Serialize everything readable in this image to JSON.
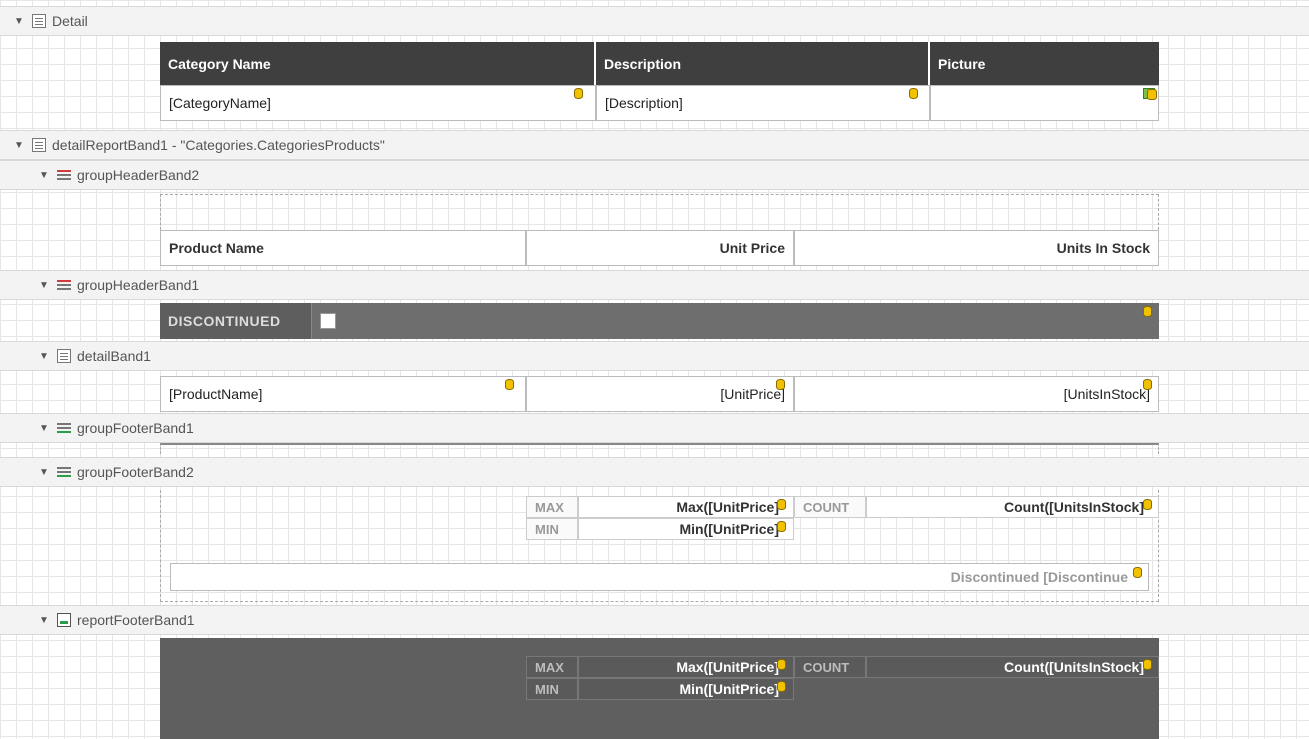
{
  "bands": {
    "detail": "Detail",
    "detailReportBand1": "detailReportBand1 - \"Categories.CategoriesProducts\"",
    "groupHeaderBand2": "groupHeaderBand2",
    "groupHeaderBand1": "groupHeaderBand1",
    "detailBand1": "detailBand1",
    "groupFooterBand1": "groupFooterBand1",
    "groupFooterBand2": "groupFooterBand2",
    "reportFooterBand1": "reportFooterBand1"
  },
  "detail": {
    "headers": [
      "Category Name",
      "Description",
      "Picture"
    ],
    "fields": [
      "[CategoryName]",
      "[Description]"
    ]
  },
  "groupHeader2": {
    "headers": [
      "Product Name",
      "Unit Price",
      "Units In Stock"
    ]
  },
  "groupHeader1": {
    "label": "DISCONTINUED"
  },
  "detailBand1": {
    "fields": [
      "[ProductName]",
      "[UnitPrice]",
      "[UnitsInStock]"
    ]
  },
  "groupFooter2": {
    "max_label": "MAX",
    "max_value": "Max([UnitPrice]",
    "count_label": "COUNT",
    "count_value": "Count([UnitsInStock]",
    "min_label": "MIN",
    "min_value": "Min([UnitPrice]",
    "discontinued": "Discontinued [Discontinue"
  },
  "reportFooter": {
    "max_label": "MAX",
    "max_value": "Max([UnitPrice]",
    "count_label": "COUNT",
    "count_value": "Count([UnitsInStock]",
    "min_label": "MIN",
    "min_value": "Min([UnitPrice]"
  },
  "colors": {
    "header_dark": "#3f3f3f",
    "group_header_fill": "#6e6e6e",
    "footer_fill": "#5f5f5f",
    "field_icon": "#f2c200"
  }
}
